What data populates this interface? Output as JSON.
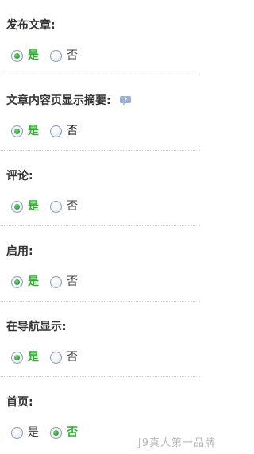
{
  "sections": [
    {
      "title": "发布文章:",
      "options": [
        {
          "label": "是",
          "checked": true
        },
        {
          "label": "否",
          "checked": false
        }
      ]
    },
    {
      "title": "文章内容页显示摘要:",
      "help_icon": "speech-bubble-icon",
      "options": [
        {
          "label": "是",
          "checked": true
        },
        {
          "label": "否",
          "checked": false
        }
      ]
    },
    {
      "title": "评论:",
      "options": [
        {
          "label": "是",
          "checked": true
        },
        {
          "label": "否",
          "checked": false
        }
      ]
    },
    {
      "title": "启用:",
      "options": [
        {
          "label": "是",
          "checked": true
        },
        {
          "label": "否",
          "checked": false
        }
      ]
    },
    {
      "title": "在导航显示:",
      "options": [
        {
          "label": "是",
          "checked": true
        },
        {
          "label": "否",
          "checked": false
        }
      ]
    },
    {
      "title": "首页:",
      "options": [
        {
          "label": "是",
          "checked": false
        },
        {
          "label": "否",
          "checked": true
        }
      ]
    }
  ],
  "watermark": "J9真人第一品牌",
  "colors": {
    "selected_label": "#2bb32b",
    "radio_border": "#8a9cb4",
    "help_icon": "#9aaed6"
  }
}
